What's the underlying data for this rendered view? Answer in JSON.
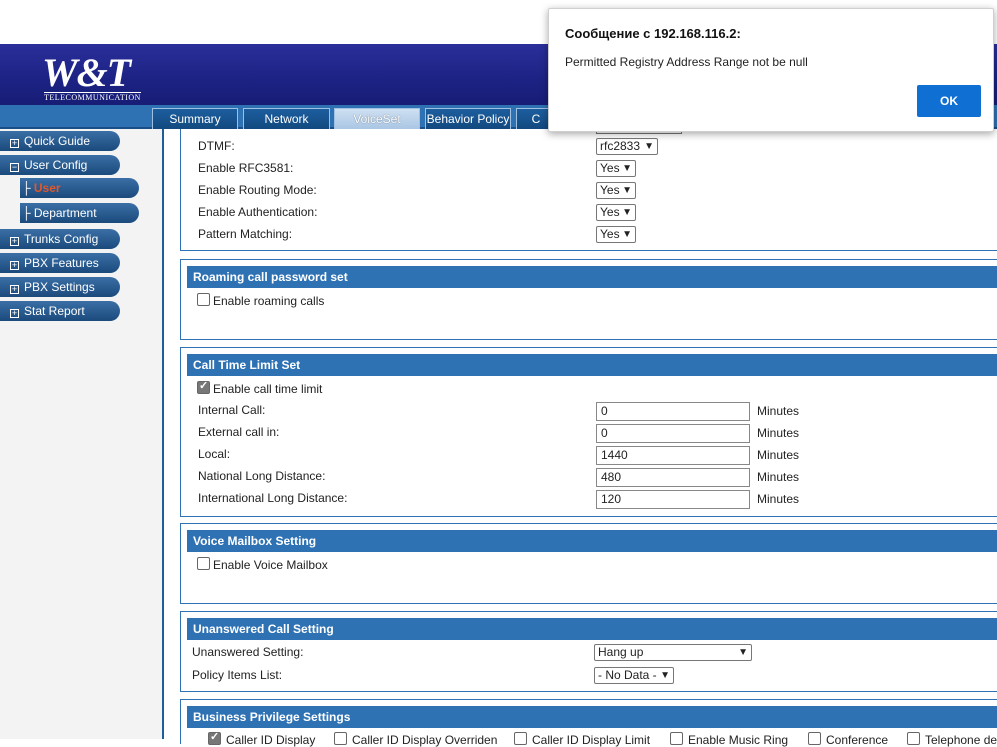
{
  "dialog": {
    "title": "Сообщение с 192.168.116.2:",
    "message": "Permitted Registry Address Range not be null",
    "ok_label": "OK"
  },
  "logo": {
    "main": "W&T",
    "sub": "TELECOMMUNICATION"
  },
  "tabs": [
    {
      "label": "Summary",
      "active": false
    },
    {
      "label": "Network",
      "active": false
    },
    {
      "label": "VoiceSet",
      "active": true
    },
    {
      "label": "Behavior Policy",
      "active": false
    },
    {
      "label": "C",
      "active": false
    }
  ],
  "sidebar": {
    "items": [
      {
        "label": "Quick Guide",
        "icon": "plus-box-icon"
      },
      {
        "label": "User Config",
        "icon": "minus-box-icon"
      },
      {
        "label": "Trunks Config",
        "icon": "plus-box-icon"
      },
      {
        "label": "PBX Features",
        "icon": "plus-box-icon"
      },
      {
        "label": "PBX Settings",
        "icon": "plus-box-icon"
      },
      {
        "label": "Stat Report",
        "icon": "plus-box-icon"
      }
    ],
    "subitems": [
      {
        "label": "User",
        "active": true
      },
      {
        "label": "Department",
        "active": false
      }
    ],
    "tree_glyph": "├"
  },
  "general": {
    "dtmf_label": "DTMF:",
    "dtmf_value": "rfc2833",
    "rfc3581_label": "Enable RFC3581:",
    "rfc3581_value": "Yes",
    "routing_label": "Enable Routing Mode:",
    "routing_value": "Yes",
    "auth_label": "Enable Authentication:",
    "auth_value": "Yes",
    "pattern_label": "Pattern Matching:",
    "pattern_value": "Yes"
  },
  "roaming": {
    "title": "Roaming call password set",
    "enable_label": "Enable roaming calls",
    "enabled": false
  },
  "call_time": {
    "title": "Call Time Limit Set",
    "enable_label": "Enable call time limit",
    "enabled": true,
    "unit": "Minutes",
    "rows": [
      {
        "label": "Internal Call:",
        "value": "0"
      },
      {
        "label": "External call in:",
        "value": "0"
      },
      {
        "label": "Local:",
        "value": "1440"
      },
      {
        "label": "National Long Distance:",
        "value": "480"
      },
      {
        "label": "International Long Distance:",
        "value": "120"
      }
    ]
  },
  "voicemail": {
    "title": "Voice Mailbox Setting",
    "enable_label": "Enable Voice Mailbox",
    "enabled": false
  },
  "unanswered": {
    "title": "Unanswered Call Setting",
    "setting_label": "Unanswered Setting:",
    "setting_value": "Hang up",
    "policy_label": "Policy Items List:",
    "policy_value": "- No Data -"
  },
  "business": {
    "title": "Business Privilege Settings",
    "items": [
      {
        "label": "Caller ID Display",
        "checked": true
      },
      {
        "label": "Caller ID Display Overriden",
        "checked": false
      },
      {
        "label": "Caller ID Display Limit",
        "checked": false
      },
      {
        "label": "Enable Music Ring",
        "checked": false
      },
      {
        "label": "Conference",
        "checked": false
      },
      {
        "label": "Telephone de",
        "checked": false
      }
    ]
  },
  "colors": {
    "accent": "#2f72b3",
    "header_bg": "#1c2283",
    "ok_button": "#0f6fd2",
    "active_sub": "#e2572b"
  }
}
